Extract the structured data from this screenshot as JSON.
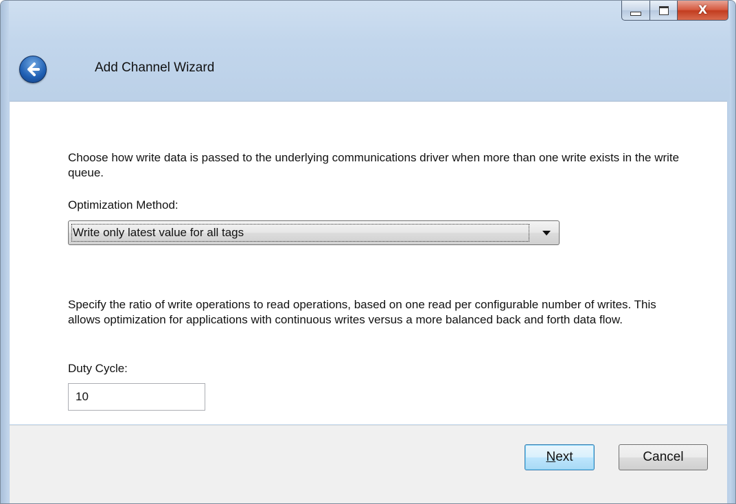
{
  "window": {
    "title": "Add Channel Wizard",
    "controls": {
      "minimize_icon": "minimize-icon",
      "maximize_icon": "maximize-icon",
      "close_glyph": "X"
    }
  },
  "header": {
    "back_icon": "back-arrow-icon"
  },
  "content": {
    "write_optimization_description": "Choose how write data is passed to the underlying communications driver when more than one write exists in the write queue.",
    "optimization_method_label": "Optimization Method:",
    "optimization_method_value": "Write only latest value for all tags",
    "duty_cycle_description": "Specify the ratio of write operations to read operations, based on one read per configurable number of writes. This allows optimization for applications with continuous writes versus a more balanced back and forth data flow.",
    "duty_cycle_label": "Duty Cycle:",
    "duty_cycle_value": "10"
  },
  "footer": {
    "next_label_mnemonic": "N",
    "next_label_rest": "ext",
    "cancel_label": "Cancel"
  },
  "colors": {
    "title_bar": "#c2d6ec",
    "close_button": "#c23c1f",
    "content_bg": "#ffffff",
    "footer_bg": "#f0f0f0"
  }
}
